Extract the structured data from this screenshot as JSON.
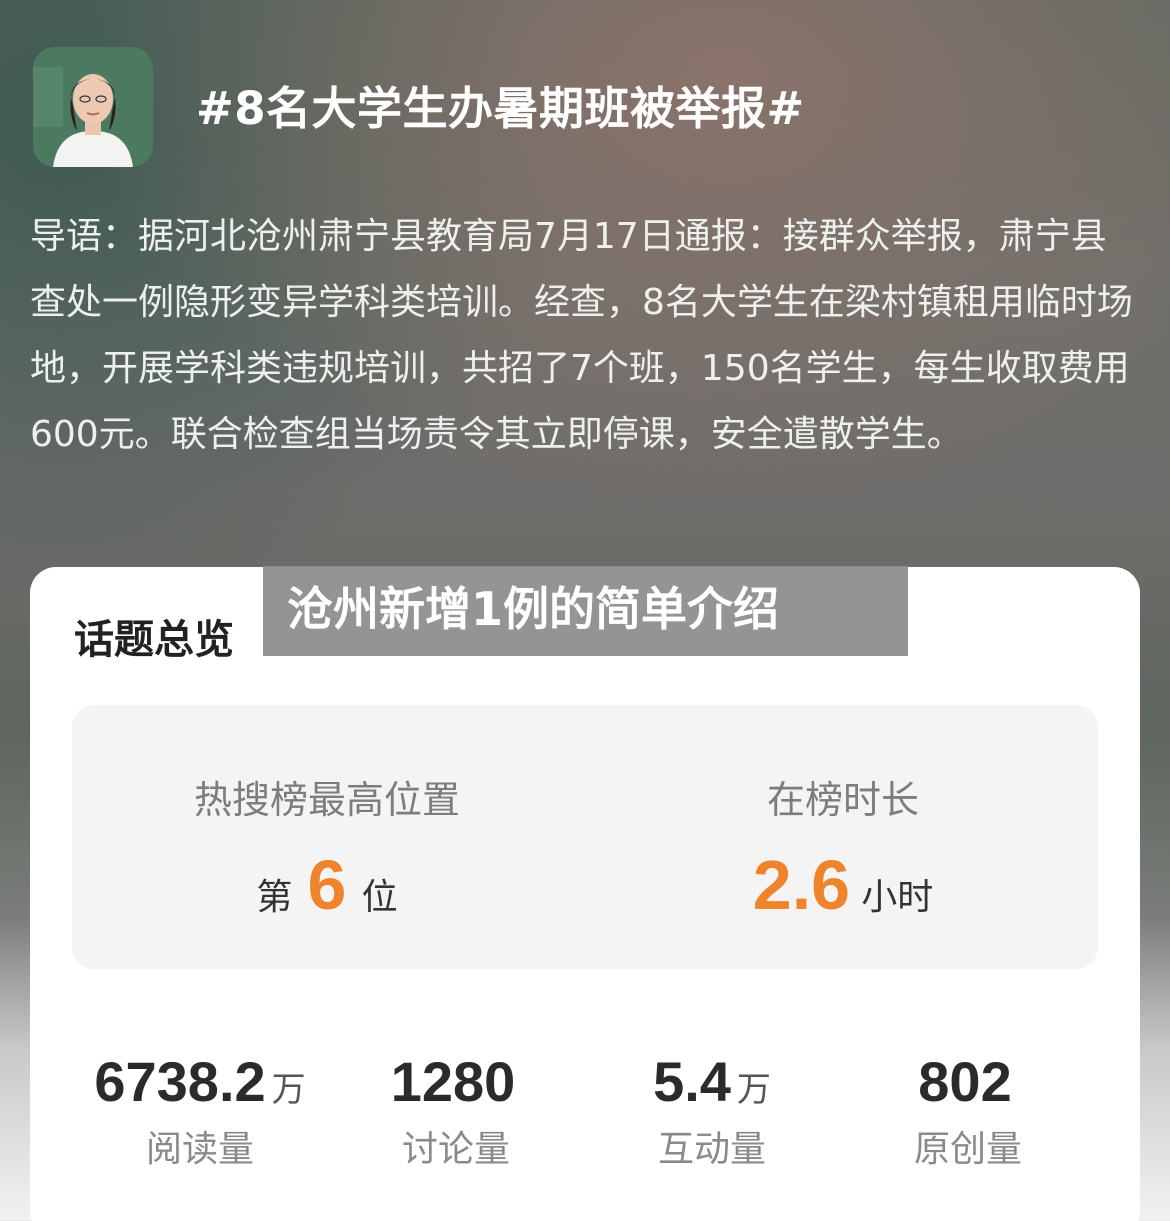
{
  "header": {
    "title": "#8名大学生办暑期班被举报#",
    "avatar_icon": "teacher-avatar"
  },
  "intro": {
    "text": "导语：据河北沧州肃宁县教育局7月17日通报：接群众举报，肃宁县查处一例隐形变异学科类培训。经查，8名大学生在梁村镇租用临时场地，开展学科类违规培训，共招了7个班，150名学生，每生收取费用600元。联合检查组当场责令其立即停课，安全遣散学生。"
  },
  "overlay": {
    "text": "沧州新增1例的简单介绍"
  },
  "card": {
    "title": "话题总览",
    "rank": {
      "label": "热搜榜最高位置",
      "prefix": "第",
      "value": "6",
      "suffix": "位"
    },
    "duration": {
      "label": "在榜时长",
      "value": "2.6",
      "suffix": "小时"
    },
    "metrics": [
      {
        "value": "6738.2",
        "unit": "万",
        "label": "阅读量"
      },
      {
        "value": "1280",
        "unit": "",
        "label": "讨论量"
      },
      {
        "value": "5.4",
        "unit": "万",
        "label": "互动量"
      },
      {
        "value": "802",
        "unit": "",
        "label": "原创量"
      }
    ],
    "accent_color": "#f0842d"
  }
}
